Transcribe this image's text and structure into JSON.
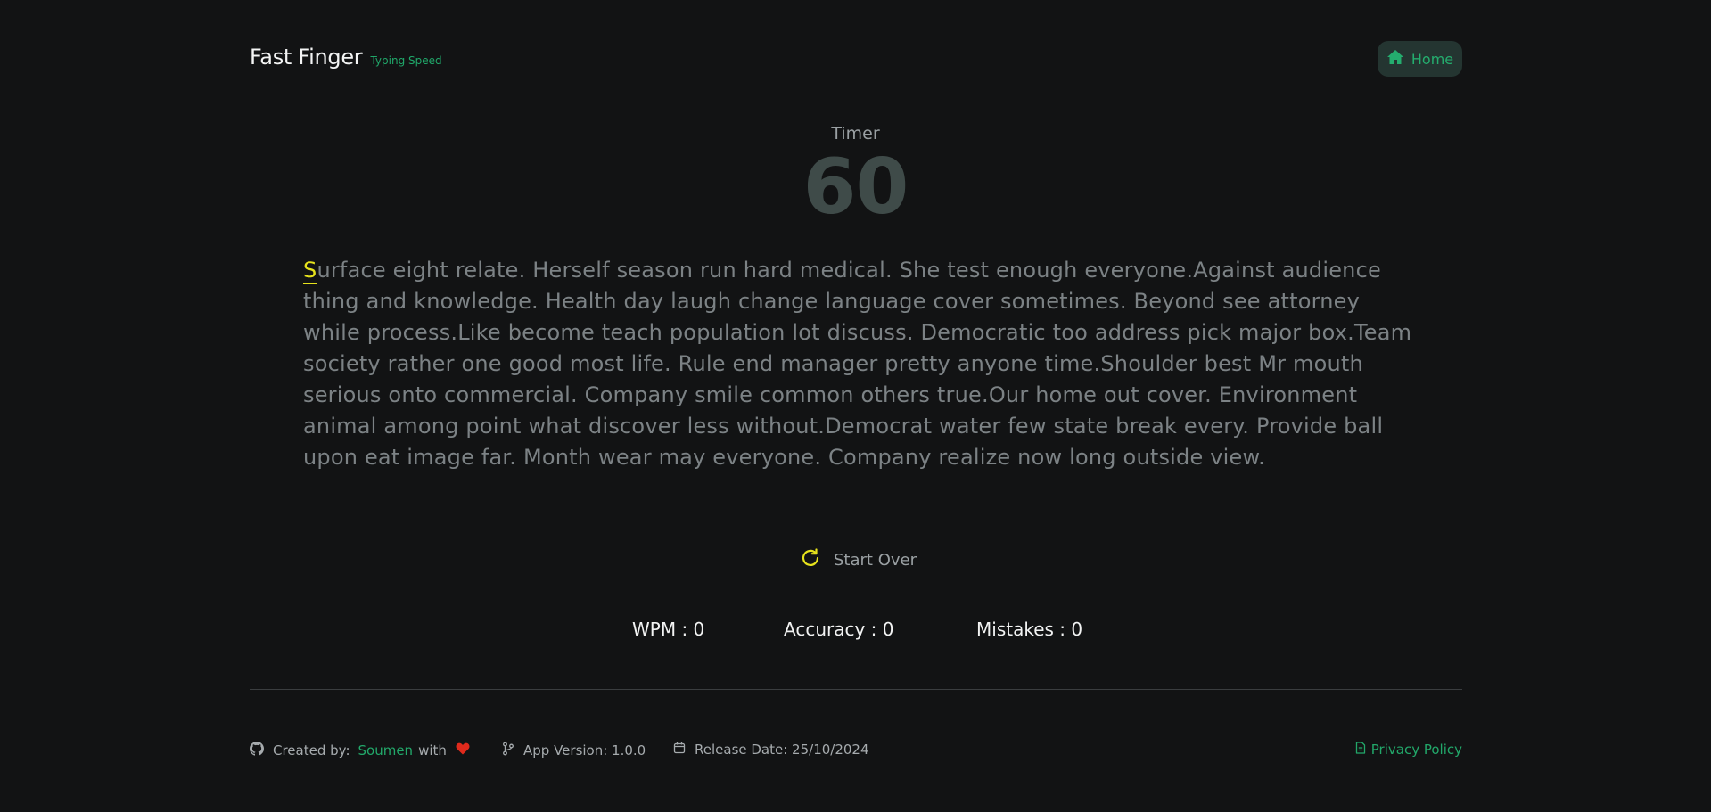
{
  "header": {
    "title": "Fast Finger",
    "subtitle": "Typing Speed",
    "home_label": "Home"
  },
  "timer": {
    "label": "Timer",
    "value": "60"
  },
  "passage": {
    "current_char": "S",
    "rest": "urface eight relate. Herself season run hard medical. She test enough everyone.Against audience thing and knowledge. Health day laugh change language cover sometimes. Beyond see attorney while process.Like become teach population lot discuss. Democratic too address pick major box.Team society rather one good most life. Rule end manager pretty anyone time.Shoulder best Mr mouth serious onto commercial. Company smile common others true.Our home out cover. Environment animal among point what discover less without.Democrat water few state break every. Provide ball upon eat image far. Month wear may everyone. Company realize now long outside view."
  },
  "controls": {
    "start_over_label": "Start Over"
  },
  "stats": {
    "wpm": "WPM : 0",
    "accuracy": "Accuracy : 0",
    "mistakes": "Mistakes : 0"
  },
  "footer": {
    "created_by_label": "Created by:",
    "author": "Soumen",
    "with_label": "with",
    "app_version": "App Version: 1.0.0",
    "release_date": "Release Date: 25/10/2024",
    "privacy_policy": "Privacy Policy"
  },
  "colors": {
    "background": "#121314",
    "accent_green": "#22a86a",
    "cursor_yellow": "#e6e21c",
    "heart_red": "#e02a1c"
  },
  "icons": {
    "home": "home-icon",
    "restart": "refresh-icon",
    "github": "github-icon",
    "heart": "heart-icon",
    "branch": "git-branch-icon",
    "calendar": "calendar-icon",
    "document": "document-icon"
  }
}
